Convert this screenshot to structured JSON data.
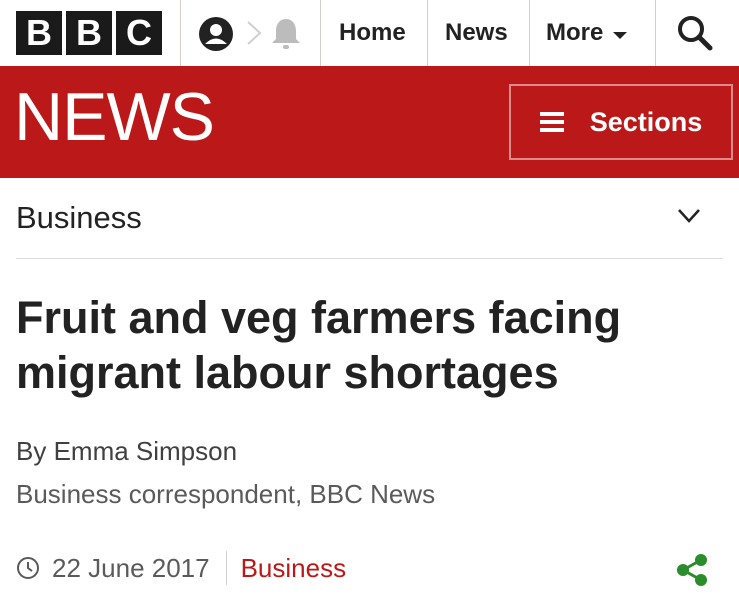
{
  "header": {
    "logo_letters": [
      "B",
      "B",
      "C"
    ],
    "nav": {
      "home": "Home",
      "news": "News",
      "more": "More"
    },
    "icons": [
      "account-icon",
      "notification-bell-icon",
      "search-icon"
    ]
  },
  "masthead": {
    "brand": "NEWS",
    "sections_label": "Sections",
    "color": "#bb1919"
  },
  "section_nav": {
    "label": "Business"
  },
  "article": {
    "headline": "Fruit and veg farmers facing migrant labour shortages",
    "author": "By Emma Simpson",
    "role": "Business correspondent, BBC News",
    "date": "22 June 2017",
    "category": "Business"
  },
  "colors": {
    "accent_red": "#bb1919",
    "share_green": "#2a8c2a"
  }
}
